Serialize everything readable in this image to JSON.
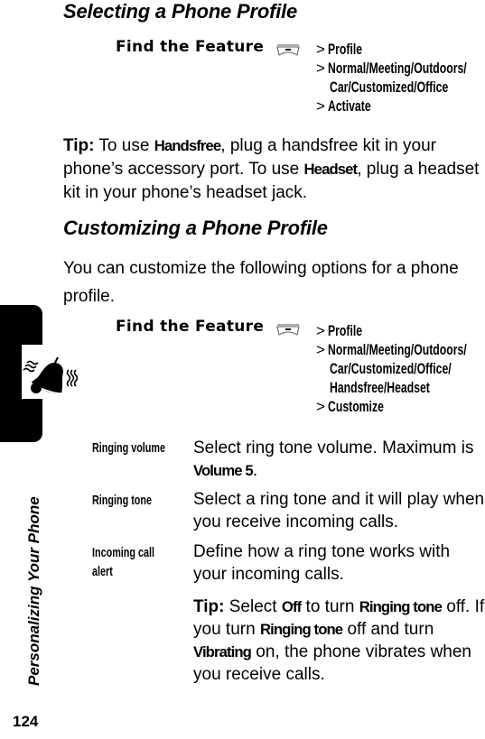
{
  "page": {
    "number": "124",
    "chapter_title": "Personalizing Your Phone",
    "chapter_icon": "ringing-bell-icon"
  },
  "section1": {
    "heading": "Selecting a Phone Profile",
    "find_feature": {
      "label": "Find the Feature",
      "key_icon": "menu-key-icon",
      "steps": [
        {
          "prefix": ">",
          "lines": [
            "Profile"
          ]
        },
        {
          "prefix": ">",
          "lines": [
            "Normal/Meeting/Outdoors/",
            "Car/Customized/Office"
          ]
        },
        {
          "prefix": ">",
          "lines": [
            "Activate"
          ]
        }
      ]
    },
    "tip": {
      "label": "Tip:",
      "t1": " To use ",
      "k1": "Handsfree",
      "t2": ", plug a handsfree kit in your phone’s accessory port. To use ",
      "k2": "Headset",
      "t3": ", plug a headset kit in your phone’s headset jack."
    }
  },
  "section2": {
    "heading": "Customizing a Phone Profile",
    "intro": "You can customize the following options for a phone profile.",
    "find_feature": {
      "label": "Find the Feature",
      "key_icon": "menu-key-icon",
      "steps": [
        {
          "prefix": ">",
          "lines": [
            "Profile"
          ]
        },
        {
          "prefix": ">",
          "lines": [
            "Normal/Meeting/Outdoors/",
            "Car/Customized/Office/",
            "Handsfree/Headset"
          ]
        },
        {
          "prefix": ">",
          "lines": [
            "Customize"
          ]
        }
      ]
    },
    "options": [
      {
        "label": "Ringing volume",
        "desc_a": "Select ring tone volume. Maximum is ",
        "desc_key": "Volume 5",
        "desc_b": "."
      },
      {
        "label": "Ringing tone",
        "desc_a": "Select a ring tone and it will play when you receive incoming calls."
      },
      {
        "label_l1": "Incoming call",
        "label_l2": "alert",
        "desc_a": "Define how a ring tone works with your incoming calls."
      }
    ],
    "tip": {
      "label": "Tip:",
      "t1": " Select ",
      "k1": "Off",
      "t2": " to turn ",
      "k2": "Ringing tone",
      "t3": " off. If you turn ",
      "k3": "Ringing tone",
      "t4": " off and turn ",
      "k4": "Vibrating",
      "t5": " on, the phone vibrates when you receive calls."
    }
  }
}
